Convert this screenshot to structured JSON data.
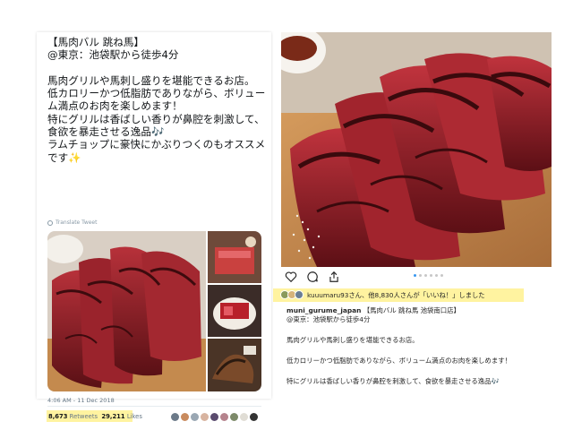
{
  "tweet": {
    "text": "【馬肉バル 跳ね馬】\n@東京：池袋駅から徒歩4分\n\n馬肉グリルや馬刺し盛りを堪能できるお店。\n低カロリーかつ低脂肪でありながら、ボリューム満点のお肉を楽しめます！\n特にグリルは香ばしい香りが鼻腔を刺激して、食欲を暴走させる逸品🎶\nラムチョップに豪快にかぶりつくのもオススメです✨",
    "translate_label": "Translate Tweet",
    "timestamp": "4:06 AM - 11 Dec 2018",
    "retweets_count": "8,673",
    "retweets_label": "Retweets",
    "likes_count": "29,211",
    "likes_label": "Likes"
  },
  "instagram": {
    "likes_text": "kuuumaru93さん、他8,830人さんが「いいね！」しました",
    "carousel_total": 6,
    "carousel_active": 1,
    "username": "muni_gurume_japan",
    "location_tag": "【馬肉バル 跳ね馬 池袋南口店】",
    "caption_line1": "@東京：池袋駅から徒歩4分",
    "caption_line2": "馬肉グリルや馬刺し盛りを堪能できるお店。",
    "caption_line3": "低カロリーかつ低脂肪でありながら、ボリューム満点のお肉を楽しめます！",
    "caption_line4": "特にグリルは香ばしい香りが鼻腔を刺激して、食欲を暴走させる逸品🎶"
  },
  "icons": [
    "globe-icon",
    "heart-icon",
    "comment-icon",
    "share-icon"
  ],
  "colors": {
    "highlight": "#fff3a0",
    "meat": "#8e1b22",
    "board": "#c48a4e",
    "carousel_active": "#3897f0"
  }
}
